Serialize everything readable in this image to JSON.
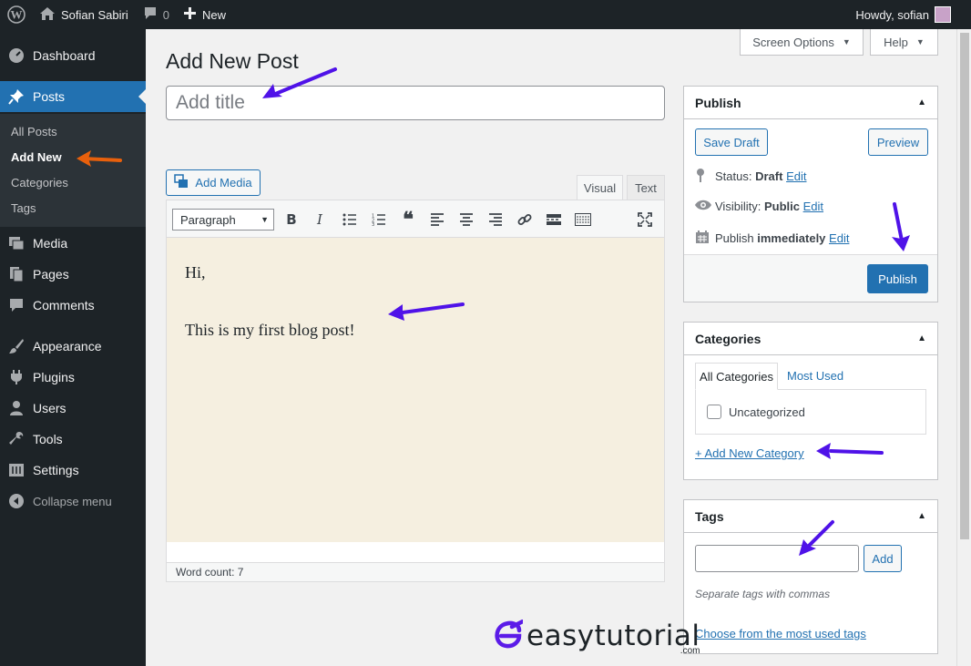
{
  "adminbar": {
    "site_name": "Sofian Sabiri",
    "comments_count": "0",
    "new_label": "New",
    "howdy": "Howdy, sofian"
  },
  "sidebar": {
    "items": [
      {
        "label": "Dashboard",
        "icon": "dashboard-icon"
      },
      {
        "label": "Posts",
        "icon": "pin-icon"
      },
      {
        "label": "Media",
        "icon": "media-icon"
      },
      {
        "label": "Pages",
        "icon": "pages-icon"
      },
      {
        "label": "Comments",
        "icon": "comment-icon"
      },
      {
        "label": "Appearance",
        "icon": "brush-icon"
      },
      {
        "label": "Plugins",
        "icon": "plugin-icon"
      },
      {
        "label": "Users",
        "icon": "users-icon"
      },
      {
        "label": "Tools",
        "icon": "wrench-icon"
      },
      {
        "label": "Settings",
        "icon": "settings-icon"
      },
      {
        "label": "Collapse menu",
        "icon": "collapse-icon"
      }
    ],
    "submenu": [
      "All Posts",
      "Add New",
      "Categories",
      "Tags"
    ]
  },
  "screen_options": "Screen Options",
  "help": "Help",
  "page_title": "Add New Post",
  "title_placeholder": "Add title",
  "editor": {
    "add_media": "Add Media",
    "tab_visual": "Visual",
    "tab_text": "Text",
    "format": "Paragraph",
    "line1": "Hi,",
    "line2": "This is my first blog post!",
    "word_count": "Word count: 7"
  },
  "publish": {
    "title": "Publish",
    "save_draft": "Save Draft",
    "preview": "Preview",
    "status_label": "Status:",
    "status_value": "Draft",
    "visibility_label": "Visibility:",
    "visibility_value": "Public",
    "publish_label": "Publish",
    "publish_value": "immediately",
    "edit": "Edit",
    "publish_button": "Publish"
  },
  "categories": {
    "title": "Categories",
    "tab_all": "All Categories",
    "tab_most_used": "Most Used",
    "items": [
      "Uncategorized"
    ],
    "add_new": "+ Add New Category"
  },
  "tags": {
    "title": "Tags",
    "add": "Add",
    "hint": "Separate tags with commas",
    "choose": "Choose from the most used tags"
  },
  "watermark": {
    "text": "easytutorial",
    "suffix": ".com"
  },
  "colors": {
    "accent": "#2271b1",
    "arrow_purple": "#4f12e8",
    "arrow_orange": "#e8600c",
    "editor_bg": "#f5efe0"
  }
}
